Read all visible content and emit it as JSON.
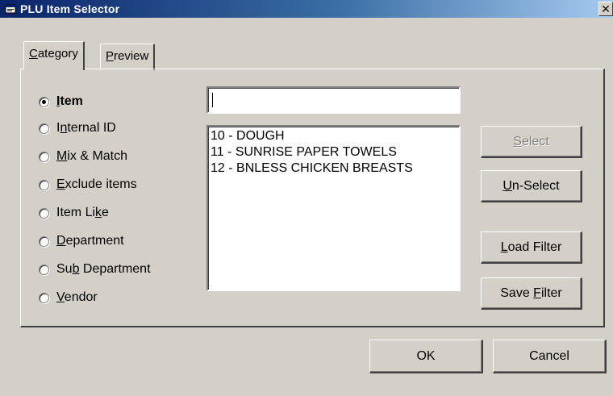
{
  "window": {
    "title": "PLU Item Selector",
    "close_glyph": "✕"
  },
  "tabs": [
    {
      "pre": "",
      "mn": "C",
      "post": "ategory",
      "active": true
    },
    {
      "pre": "",
      "mn": "P",
      "post": "review",
      "active": false
    }
  ],
  "radios": [
    {
      "pre": "",
      "mn": "I",
      "post": "tem",
      "checked": true,
      "bold": true
    },
    {
      "pre": "I",
      "mn": "n",
      "post": "ternal ID",
      "checked": false,
      "bold": false
    },
    {
      "pre": "",
      "mn": "M",
      "post": "ix & Match",
      "checked": false,
      "bold": false
    },
    {
      "pre": "",
      "mn": "E",
      "post": "xclude items",
      "checked": false,
      "bold": false
    },
    {
      "pre": "Item Li",
      "mn": "k",
      "post": "e",
      "checked": false,
      "bold": false
    },
    {
      "pre": "",
      "mn": "D",
      "post": "epartment",
      "checked": false,
      "bold": false
    },
    {
      "pre": "Su",
      "mn": "b",
      "post": " Department",
      "checked": false,
      "bold": false
    },
    {
      "pre": "",
      "mn": "V",
      "post": "endor",
      "checked": false,
      "bold": false
    }
  ],
  "search": {
    "value": ""
  },
  "list": {
    "items": [
      "10 - DOUGH",
      "11 - SUNRISE PAPER TOWELS",
      "12 - BNLESS CHICKEN BREASTS"
    ]
  },
  "buttons": {
    "select": {
      "pre": "",
      "mn": "S",
      "post": "elect",
      "enabled": false
    },
    "unselect": {
      "pre": "",
      "mn": "U",
      "post": "n-Select",
      "enabled": true
    },
    "load_filter": {
      "pre": "",
      "mn": "L",
      "post": "oad Filter",
      "enabled": true
    },
    "save_filter": {
      "pre": "Save ",
      "mn": "F",
      "post": "ilter",
      "enabled": true
    },
    "ok": {
      "label": "OK"
    },
    "cancel": {
      "label": "Cancel"
    }
  },
  "colors": {
    "titlebar_start": "#0a246a",
    "titlebar_end": "#a6caf0",
    "face": "#d4d0c8",
    "disabled_text": "#808080"
  }
}
